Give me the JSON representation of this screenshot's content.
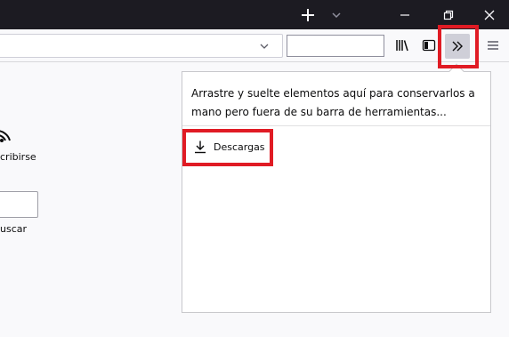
{
  "titlebar": {
    "new_tab_icon": "plus-icon",
    "tab_list_icon": "chevron-down-icon",
    "minimize_icon": "minimize-icon",
    "restore_icon": "restore-icon",
    "close_icon": "close-icon"
  },
  "toolbar": {
    "url_value": "",
    "search_value": "",
    "url_dropdown_icon": "chevron-down-icon",
    "library_icon": "library-icon",
    "sidebar_icon": "sidebar-icon",
    "overflow_icon": "double-chevron-right-icon",
    "menu_icon": "hamburger-menu-icon"
  },
  "page": {
    "subscribe_label": "cribirse",
    "search_field_value": "",
    "search_label": "uscar"
  },
  "overflow_panel": {
    "message": "Arrastre y suelte elementos aquí para conservarlos a mano pero fuera de su barra de herramientas...",
    "items": [
      {
        "label": "Descargas",
        "icon": "download-icon"
      }
    ]
  },
  "colors": {
    "titlebar": "#1c1b22",
    "toolbar": "#f9f9fb",
    "highlight": "#e01b24",
    "overflow_button_bg": "#cfcfd8"
  }
}
